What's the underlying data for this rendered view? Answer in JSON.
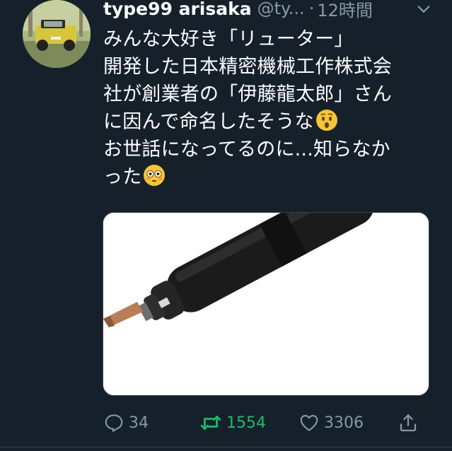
{
  "tweet": {
    "display_name": "type99 arisaka",
    "handle": "@ty...",
    "separator": "·",
    "time": "12時間",
    "text_lines": [
      "みんな大好き「リューター」",
      "開発した日本精密機械工作株式会",
      "社が創業者の「伊藤龍太郎」さん",
      "に因んで命名したそうな",
      "お世話になってるのに...知らなか",
      "った"
    ]
  },
  "actions": {
    "reply_count": "34",
    "retweet_count": "1554",
    "like_count": "3306"
  },
  "colors": {
    "background": "#15202b",
    "secondary_text": "#8899a6",
    "retweet_active": "#17bf63"
  },
  "icons": {
    "menu": "chevron-down-icon",
    "reply": "reply-icon",
    "retweet": "retweet-icon",
    "like": "heart-icon",
    "share": "share-icon"
  }
}
